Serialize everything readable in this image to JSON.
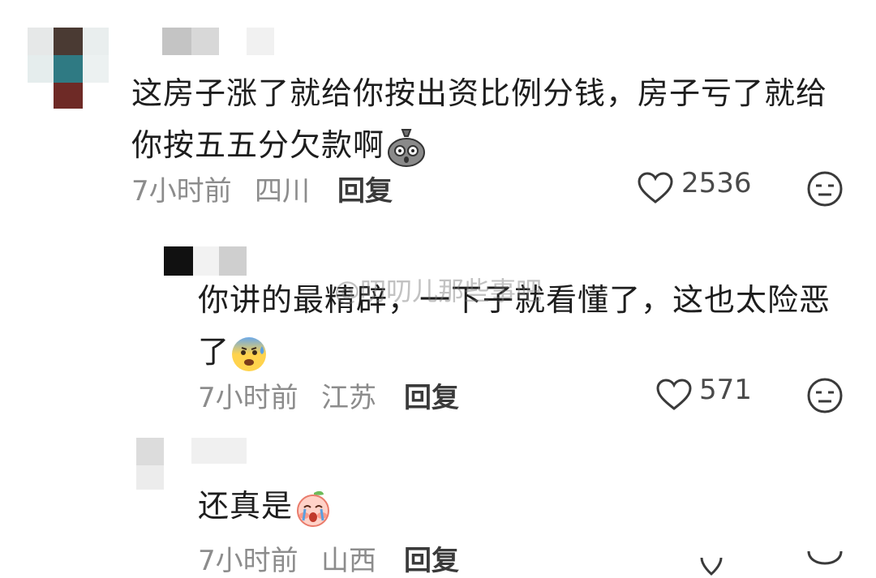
{
  "comments": [
    {
      "line1": "这房子涨了就给你按出资比例分钱，房子亏了就给",
      "line2": "你按五五分欠款啊",
      "time": "7小时前",
      "location": "四川",
      "reply_label": "回复",
      "likes": "2536",
      "emoji": "money-bag-shocked"
    },
    {
      "line1": "你讲的最精辟，一下子就看懂了，这也太险恶",
      "line2": "了",
      "time": "7小时前",
      "location": "江苏",
      "reply_label": "回复",
      "likes": "571",
      "emoji": "anxious-face-with-sweat"
    },
    {
      "line1": "还真是",
      "time": "7小时前",
      "location": "山西",
      "reply_label": "回复",
      "emoji": "crying-peach"
    }
  ],
  "watermark": "@叨叨儿那些事吧",
  "colors": {
    "text": "#1d1d1d",
    "meta": "#8c8c8c"
  }
}
